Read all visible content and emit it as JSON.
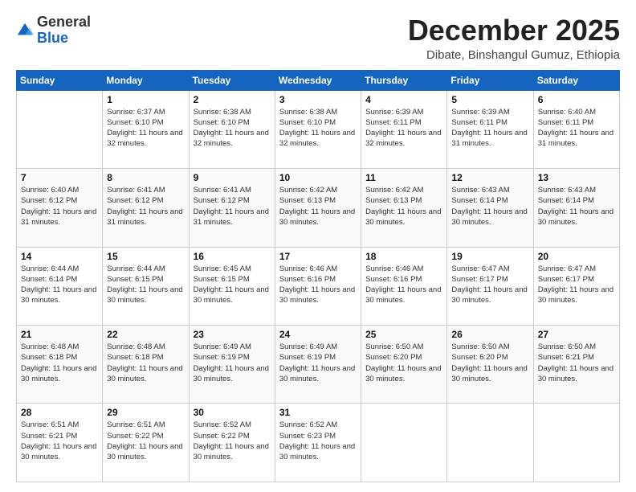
{
  "logo": {
    "general": "General",
    "blue": "Blue"
  },
  "header": {
    "month_year": "December 2025",
    "location": "Dibate, Binshangul Gumuz, Ethiopia"
  },
  "days_of_week": [
    "Sunday",
    "Monday",
    "Tuesday",
    "Wednesday",
    "Thursday",
    "Friday",
    "Saturday"
  ],
  "weeks": [
    [
      {
        "day": "",
        "info": ""
      },
      {
        "day": "1",
        "info": "Sunrise: 6:37 AM\nSunset: 6:10 PM\nDaylight: 11 hours\nand 32 minutes."
      },
      {
        "day": "2",
        "info": "Sunrise: 6:38 AM\nSunset: 6:10 PM\nDaylight: 11 hours\nand 32 minutes."
      },
      {
        "day": "3",
        "info": "Sunrise: 6:38 AM\nSunset: 6:10 PM\nDaylight: 11 hours\nand 32 minutes."
      },
      {
        "day": "4",
        "info": "Sunrise: 6:39 AM\nSunset: 6:11 PM\nDaylight: 11 hours\nand 32 minutes."
      },
      {
        "day": "5",
        "info": "Sunrise: 6:39 AM\nSunset: 6:11 PM\nDaylight: 11 hours\nand 31 minutes."
      },
      {
        "day": "6",
        "info": "Sunrise: 6:40 AM\nSunset: 6:11 PM\nDaylight: 11 hours\nand 31 minutes."
      }
    ],
    [
      {
        "day": "7",
        "info": "Sunrise: 6:40 AM\nSunset: 6:12 PM\nDaylight: 11 hours\nand 31 minutes."
      },
      {
        "day": "8",
        "info": "Sunrise: 6:41 AM\nSunset: 6:12 PM\nDaylight: 11 hours\nand 31 minutes."
      },
      {
        "day": "9",
        "info": "Sunrise: 6:41 AM\nSunset: 6:12 PM\nDaylight: 11 hours\nand 31 minutes."
      },
      {
        "day": "10",
        "info": "Sunrise: 6:42 AM\nSunset: 6:13 PM\nDaylight: 11 hours\nand 30 minutes."
      },
      {
        "day": "11",
        "info": "Sunrise: 6:42 AM\nSunset: 6:13 PM\nDaylight: 11 hours\nand 30 minutes."
      },
      {
        "day": "12",
        "info": "Sunrise: 6:43 AM\nSunset: 6:14 PM\nDaylight: 11 hours\nand 30 minutes."
      },
      {
        "day": "13",
        "info": "Sunrise: 6:43 AM\nSunset: 6:14 PM\nDaylight: 11 hours\nand 30 minutes."
      }
    ],
    [
      {
        "day": "14",
        "info": "Sunrise: 6:44 AM\nSunset: 6:14 PM\nDaylight: 11 hours\nand 30 minutes."
      },
      {
        "day": "15",
        "info": "Sunrise: 6:44 AM\nSunset: 6:15 PM\nDaylight: 11 hours\nand 30 minutes."
      },
      {
        "day": "16",
        "info": "Sunrise: 6:45 AM\nSunset: 6:15 PM\nDaylight: 11 hours\nand 30 minutes."
      },
      {
        "day": "17",
        "info": "Sunrise: 6:46 AM\nSunset: 6:16 PM\nDaylight: 11 hours\nand 30 minutes."
      },
      {
        "day": "18",
        "info": "Sunrise: 6:46 AM\nSunset: 6:16 PM\nDaylight: 11 hours\nand 30 minutes."
      },
      {
        "day": "19",
        "info": "Sunrise: 6:47 AM\nSunset: 6:17 PM\nDaylight: 11 hours\nand 30 minutes."
      },
      {
        "day": "20",
        "info": "Sunrise: 6:47 AM\nSunset: 6:17 PM\nDaylight: 11 hours\nand 30 minutes."
      }
    ],
    [
      {
        "day": "21",
        "info": "Sunrise: 6:48 AM\nSunset: 6:18 PM\nDaylight: 11 hours\nand 30 minutes."
      },
      {
        "day": "22",
        "info": "Sunrise: 6:48 AM\nSunset: 6:18 PM\nDaylight: 11 hours\nand 30 minutes."
      },
      {
        "day": "23",
        "info": "Sunrise: 6:49 AM\nSunset: 6:19 PM\nDaylight: 11 hours\nand 30 minutes."
      },
      {
        "day": "24",
        "info": "Sunrise: 6:49 AM\nSunset: 6:19 PM\nDaylight: 11 hours\nand 30 minutes."
      },
      {
        "day": "25",
        "info": "Sunrise: 6:50 AM\nSunset: 6:20 PM\nDaylight: 11 hours\nand 30 minutes."
      },
      {
        "day": "26",
        "info": "Sunrise: 6:50 AM\nSunset: 6:20 PM\nDaylight: 11 hours\nand 30 minutes."
      },
      {
        "day": "27",
        "info": "Sunrise: 6:50 AM\nSunset: 6:21 PM\nDaylight: 11 hours\nand 30 minutes."
      }
    ],
    [
      {
        "day": "28",
        "info": "Sunrise: 6:51 AM\nSunset: 6:21 PM\nDaylight: 11 hours\nand 30 minutes."
      },
      {
        "day": "29",
        "info": "Sunrise: 6:51 AM\nSunset: 6:22 PM\nDaylight: 11 hours\nand 30 minutes."
      },
      {
        "day": "30",
        "info": "Sunrise: 6:52 AM\nSunset: 6:22 PM\nDaylight: 11 hours\nand 30 minutes."
      },
      {
        "day": "31",
        "info": "Sunrise: 6:52 AM\nSunset: 6:23 PM\nDaylight: 11 hours\nand 30 minutes."
      },
      {
        "day": "",
        "info": ""
      },
      {
        "day": "",
        "info": ""
      },
      {
        "day": "",
        "info": ""
      }
    ]
  ]
}
